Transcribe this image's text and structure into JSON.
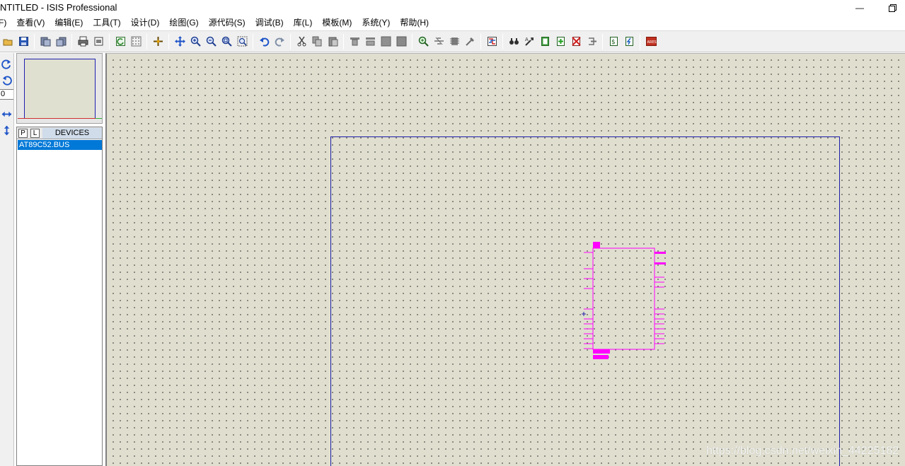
{
  "window": {
    "title": "NTITLED - ISIS Professional",
    "minimize_glyph": "—"
  },
  "menu": {
    "items": [
      {
        "label": "F)"
      },
      {
        "label": "查看(V)"
      },
      {
        "label": "编辑(E)"
      },
      {
        "label": "工具(T)"
      },
      {
        "label": "设计(D)"
      },
      {
        "label": "绘图(G)"
      },
      {
        "label": "源代码(S)"
      },
      {
        "label": "调试(B)"
      },
      {
        "label": "库(L)"
      },
      {
        "label": "模板(M)"
      },
      {
        "label": "系统(Y)"
      },
      {
        "label": "帮助(H)"
      }
    ]
  },
  "toolbar": {
    "icons": [
      "open-icon",
      "save-icon",
      "import-section-icon",
      "export-section-icon",
      "print-icon",
      "print-area-icon",
      "refresh-icon",
      "grid-toggle-icon",
      "origin-icon",
      "pan-icon",
      "zoom-in-icon",
      "zoom-out-icon",
      "zoom-all-icon",
      "zoom-area-icon",
      "undo-icon",
      "redo-icon",
      "cut-icon",
      "copy-icon",
      "paste-icon",
      "block-copy-icon",
      "block-move-icon",
      "block-rotate-icon",
      "block-delete-icon",
      "pick-device-icon",
      "make-device-icon",
      "packaging-tool-icon",
      "decompose-icon",
      "wire-autorouter-icon",
      "search-tag-icon",
      "property-tool-icon",
      "new-sheet-icon",
      "add-sheet-icon",
      "remove-sheet-icon",
      "exit-to-parent-icon",
      "bill-of-materials-icon",
      "electrical-rule-check-icon",
      "ares-netlist-icon"
    ],
    "ares_label": "ARES"
  },
  "left_tools": {
    "rotate_angle": "0"
  },
  "device_selector": {
    "p_button": "P",
    "l_button": "L",
    "title": "DEVICES",
    "items": [
      "AT89C52.BUS"
    ]
  },
  "watermark": "https://blog.csdn.net/weixin_44225182",
  "colors": {
    "canvas": "#e0dfcf",
    "sheet_border": "#1c1ca8",
    "component": "#ff00ff",
    "selection": "#0078d7"
  }
}
